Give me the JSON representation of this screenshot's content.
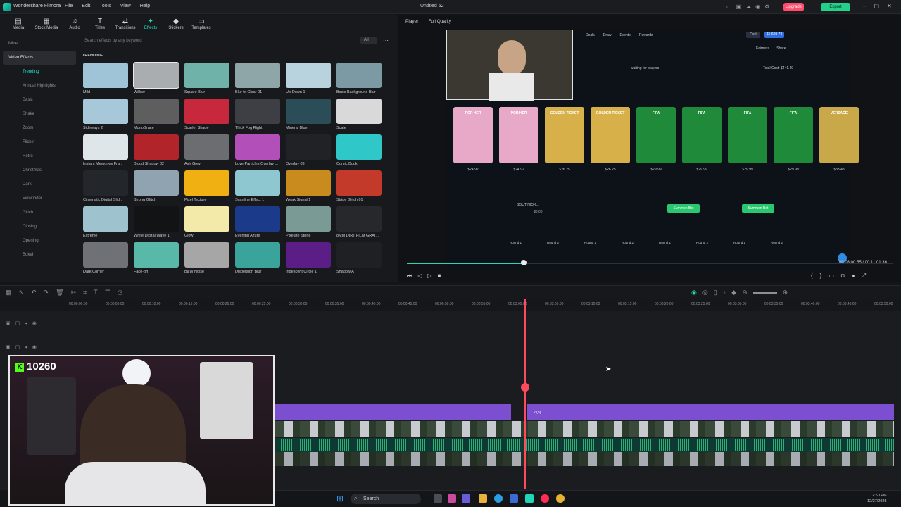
{
  "titlebar": {
    "app_name": "Wondershare Filmora",
    "menu": [
      "File",
      "Edit",
      "Tools",
      "View",
      "Help"
    ],
    "doc_title": "Untitled 52",
    "upgrade_label": "Upgrade",
    "export_label": "Export"
  },
  "top_tabs": [
    {
      "label": "Media",
      "icon": "media-icon"
    },
    {
      "label": "Stock Media",
      "icon": "stock-media-icon"
    },
    {
      "label": "Audio",
      "icon": "audio-icon"
    },
    {
      "label": "Titles",
      "icon": "titles-icon"
    },
    {
      "label": "Transitions",
      "icon": "transitions-icon"
    },
    {
      "label": "Effects",
      "icon": "effects-icon",
      "active": true
    },
    {
      "label": "Stickers",
      "icon": "stickers-icon"
    },
    {
      "label": "Templates",
      "icon": "templates-icon"
    }
  ],
  "categories": [
    "Mine",
    "Video Effects",
    "Trending",
    "Annual Highlights",
    "Basic",
    "Shake",
    "Zoom",
    "Flicker",
    "Retro",
    "Christmas",
    "Dark",
    "Viewfinder",
    "Glitch",
    "Closing",
    "Opening",
    "Bokeh"
  ],
  "search": {
    "placeholder": "Search effects by any keyword",
    "filter": "All"
  },
  "section_label": "TRENDING",
  "effects": [
    {
      "name": "Mild",
      "color": "#9fc4d8"
    },
    {
      "name": "Willow",
      "color": "#a9adb0"
    },
    {
      "name": "Square Blur",
      "color": "#6fb2a9"
    },
    {
      "name": "Blur to Clear 01",
      "color": "#8fa6a8"
    },
    {
      "name": "Up-Down 1",
      "color": "#b9d3de"
    },
    {
      "name": "Basic Background Blur",
      "color": "#7c9aa3"
    },
    {
      "name": "Sideways 2",
      "color": "#a7c8d8"
    },
    {
      "name": "MonoGrace",
      "color": "#5e5e5e"
    },
    {
      "name": "Scarlet Shade",
      "color": "#c7283c"
    },
    {
      "name": "Thick Fog Right",
      "color": "#3d3f44"
    },
    {
      "name": "Mineral Blue",
      "color": "#2b4d58"
    },
    {
      "name": "Scale",
      "color": "#d9d9d9"
    },
    {
      "name": "Instant Memories Fra...",
      "color": "#dfe6ea"
    },
    {
      "name": "Blood Shadow 02",
      "color": "#b0242a"
    },
    {
      "name": "Ash Grey",
      "color": "#6b6d70"
    },
    {
      "name": "Love Particles Overlay ...",
      "color": "#b34fb8"
    },
    {
      "name": "Overlay 03",
      "color": "#202226"
    },
    {
      "name": "Comic Book",
      "color": "#2fc7c7"
    },
    {
      "name": "Cinematic Digital Slid...",
      "color": "#23262a"
    },
    {
      "name": "Strong Glitch",
      "color": "#8fa3b0"
    },
    {
      "name": "Pixel Texture",
      "color": "#f0b012"
    },
    {
      "name": "Scanline Effect 1",
      "color": "#8ec7cf"
    },
    {
      "name": "Weak Signal 1",
      "color": "#c98a1e"
    },
    {
      "name": "Stripe Glitch 01",
      "color": "#c43a2a"
    },
    {
      "name": "Extreme",
      "color": "#9fc2cf"
    },
    {
      "name": "White Digital Wave 1",
      "color": "#121314"
    },
    {
      "name": "Glow",
      "color": "#f3e9a8"
    },
    {
      "name": "Evening Azure",
      "color": "#1b3a8a"
    },
    {
      "name": "Pixelate Stone",
      "color": "#7a9a96"
    },
    {
      "name": "8MM DIRT FILM GRAI...",
      "color": "#26282c"
    },
    {
      "name": "Dark Corner",
      "color": "#6e7175"
    },
    {
      "name": "Face-off",
      "color": "#58b9a9"
    },
    {
      "name": "B&W Noise",
      "color": "#a6a6a6"
    },
    {
      "name": "Dispersion Blur",
      "color": "#3aa39a"
    },
    {
      "name": "Iridescent Circle 1",
      "color": "#5a1e86"
    },
    {
      "name": "Shadow A",
      "color": "#1e2023"
    }
  ],
  "player": {
    "label": "Player",
    "quality": "Full Quality",
    "current_time": "00:03:00:55",
    "total_time": "00:11:01:36",
    "progress": 0.24
  },
  "preview_text": {
    "nav": [
      "Deals",
      "Draw",
      "Events",
      "Rewards"
    ],
    "cart": "Cart",
    "balance": "$1,669.73",
    "fairness": "Fairness",
    "share": "Share",
    "waiting": "waiting for players",
    "total_cost": "Total Cost: $441.49",
    "prices": [
      "$24.92",
      "$24.92",
      "$26.25",
      "$26.25",
      "$29.99",
      "$29.99",
      "$29.99",
      "$29.99",
      "$33.48"
    ],
    "card_labels": [
      "POR HER",
      "POR HER",
      "GOLDEN TICKET",
      "GOLDEN TICKET",
      "FIFA",
      "FIFA",
      "FIFA",
      "FIFA",
      "VERSACE"
    ],
    "player_name": "BOUTINIOK...",
    "player_amount": "$0.00",
    "summon": "Summon Bot",
    "rounds": [
      "Round 1",
      "Round 2",
      "Round 1",
      "Round 2",
      "Round 1",
      "Round 2",
      "Round 1",
      "Round 2"
    ]
  },
  "ruler": [
    "00:00:00:00",
    "00:00:05:00",
    "00:00:10:00",
    "00:00:15:00",
    "00:00:20:00",
    "00:00:25:00",
    "00:00:30:00",
    "00:00:35:00",
    "00:00:40:00",
    "00:00:45:00",
    "00:00:50:00",
    "00:00:55:00",
    "00:03:00:00",
    "00:03:05:00",
    "00:03:10:00",
    "00:03:15:00",
    "00:03:20:00",
    "00:03:25:00",
    "00:03:30:00",
    "00:03:35:00",
    "00:03:40:00",
    "00:03:45:00",
    "00:03:50:00"
  ],
  "clip_label": "2 (3)",
  "webcam": {
    "count": "10260",
    "k": "K"
  },
  "taskbar": {
    "search": "Search",
    "time": "2:50 PM",
    "date": "12/27/2025"
  }
}
